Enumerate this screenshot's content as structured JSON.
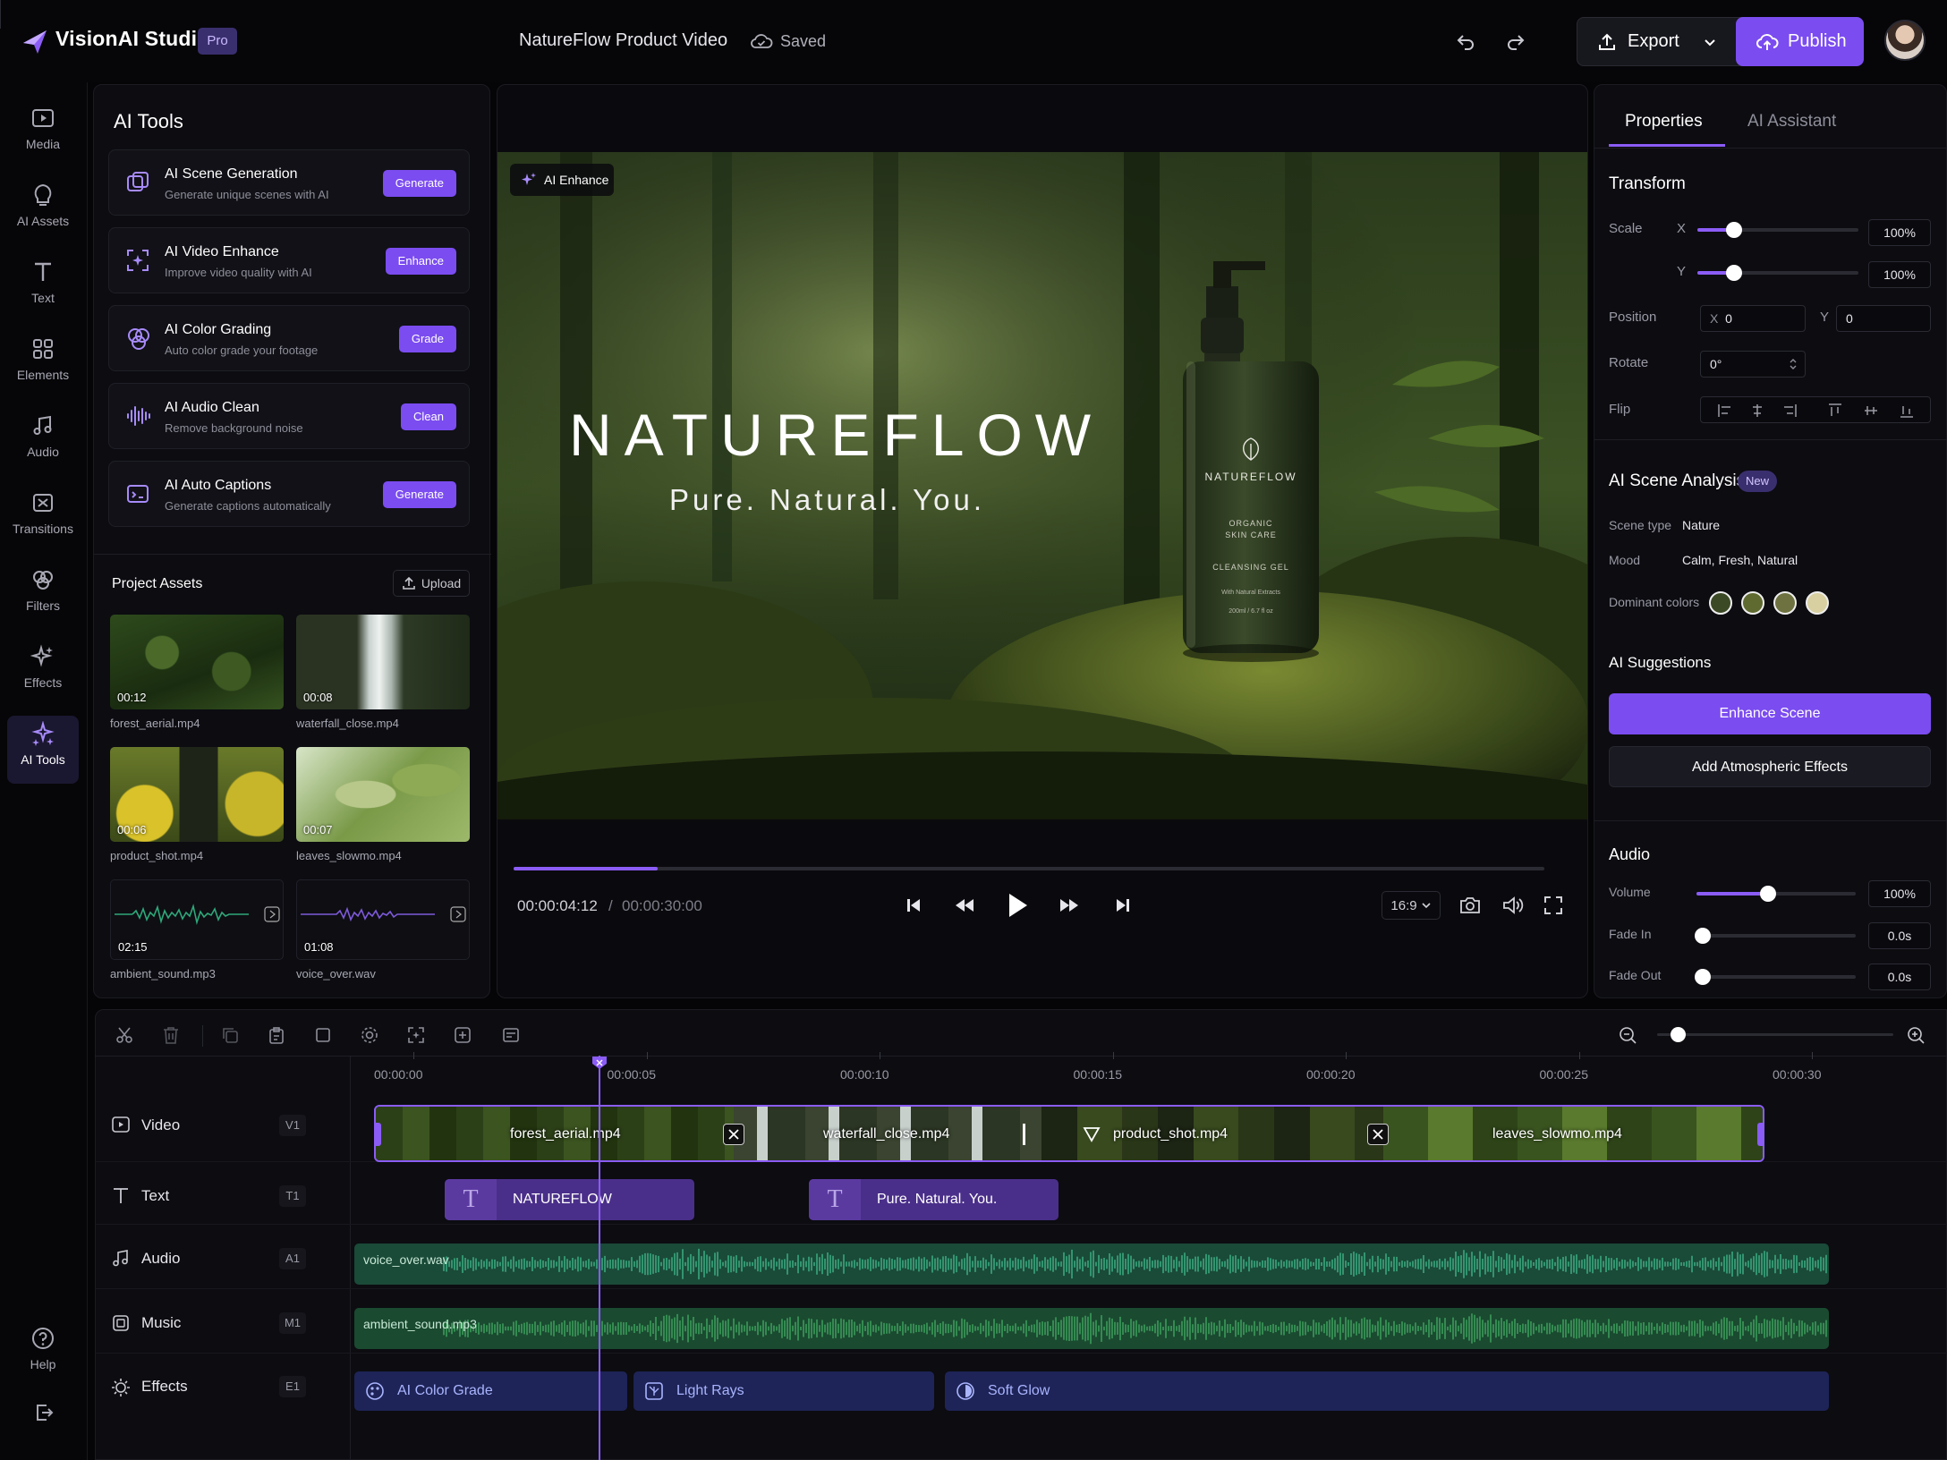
{
  "app": {
    "brand": "VisionAI Studio",
    "badge": "Pro",
    "project_title": "NatureFlow Product Video",
    "save_status": "Saved",
    "export_label": "Export",
    "publish_label": "Publish",
    "accent_color": "#7b4cf0"
  },
  "rail": {
    "items": [
      {
        "label": "Media",
        "icon": "media-icon"
      },
      {
        "label": "AI Assets",
        "icon": "ai-assets-icon"
      },
      {
        "label": "Text",
        "icon": "text-icon"
      },
      {
        "label": "Elements",
        "icon": "elements-icon"
      },
      {
        "label": "Audio",
        "icon": "audio-icon"
      },
      {
        "label": "Transitions",
        "icon": "transitions-icon"
      },
      {
        "label": "Filters",
        "icon": "filters-icon"
      },
      {
        "label": "Effects",
        "icon": "effects-icon"
      },
      {
        "label": "AI Tools",
        "icon": "ai-tools-icon",
        "active": true
      }
    ],
    "help_label": "Help"
  },
  "ai_tools": {
    "title": "AI Tools",
    "tools": [
      {
        "name": "AI Scene Generation",
        "desc": "Generate unique scenes with AI",
        "button": "Generate"
      },
      {
        "name": "AI Video Enhance",
        "desc": "Improve video quality with AI",
        "button": "Enhance"
      },
      {
        "name": "AI Color Grading",
        "desc": "Auto color grade your footage",
        "button": "Grade"
      },
      {
        "name": "AI Audio Clean",
        "desc": "Remove background noise",
        "button": "Clean"
      },
      {
        "name": "AI Auto Captions",
        "desc": "Generate captions automatically",
        "button": "Generate"
      }
    ]
  },
  "assets": {
    "title": "Project Assets",
    "upload_label": "Upload",
    "items": [
      {
        "name": "forest_aerial.mp4",
        "duration": "00:12"
      },
      {
        "name": "waterfall_close.mp4",
        "duration": "00:08"
      },
      {
        "name": "product_shot.mp4",
        "duration": "00:06"
      },
      {
        "name": "leaves_slowmo.mp4",
        "duration": "00:07"
      },
      {
        "name": "ambient_sound.mp3",
        "duration": "02:15"
      },
      {
        "name": "voice_over.wav",
        "duration": "01:08"
      }
    ]
  },
  "preview": {
    "badge": "AI Enhance",
    "hero_title": "NATUREFLOW",
    "hero_subtitle": "Pure. Natural. You.",
    "bottle_brand": "NATUREFLOW",
    "bottle_line1": "ORGANIC",
    "bottle_line2": "SKIN CARE",
    "bottle_product": "CLEANSING GEL",
    "bottle_note": "With Natural Extracts",
    "bottle_volume": "200ml / 6.7 fl oz",
    "current_time": "00:00:04:12",
    "separator": "/",
    "total_time": "00:00:30:00",
    "aspect_ratio": "16:9",
    "progress": 0.14
  },
  "properties": {
    "tabs": [
      "Properties",
      "AI Assistant"
    ],
    "transform": {
      "title": "Transform",
      "scale_label": "Scale",
      "x_label": "X",
      "y_label": "Y",
      "scale_x": "100%",
      "scale_y": "100%",
      "position_label": "Position",
      "pos_x": "0",
      "pos_y": "0",
      "rotate_label": "Rotate",
      "rotate": "0°",
      "flip_label": "Flip"
    },
    "scene_analysis": {
      "title": "AI Scene Analysis",
      "badge": "New",
      "scene_type_label": "Scene type",
      "scene_type": "Nature",
      "mood_label": "Mood",
      "mood": "Calm, Fresh, Natural",
      "colors_label": "Dominant colors",
      "colors": [
        "#3b4a25",
        "#5f6a30",
        "#6e7240",
        "#d8d0a0"
      ]
    },
    "suggestions": {
      "title": "AI Suggestions",
      "primary": "Enhance Scene",
      "secondary": "Add Atmospheric Effects"
    },
    "audio": {
      "title": "Audio",
      "volume_label": "Volume",
      "volume": "100%",
      "volume_level": 0.45,
      "fade_in_label": "Fade In",
      "fade_in": "0.0s",
      "fade_out_label": "Fade Out",
      "fade_out": "0.0s"
    }
  },
  "timeline": {
    "ruler": [
      "00:00:00",
      "00:00:05",
      "00:00:10",
      "00:00:15",
      "00:00:20",
      "00:00:25",
      "00:00:30"
    ],
    "tracks": [
      {
        "name": "Video",
        "id": "V1"
      },
      {
        "name": "Text",
        "id": "T1"
      },
      {
        "name": "Audio",
        "id": "A1"
      },
      {
        "name": "Music",
        "id": "M1"
      },
      {
        "name": "Effects",
        "id": "E1"
      }
    ],
    "video_clips": [
      "forest_aerial.mp4",
      "waterfall_close.mp4",
      "product_shot.mp4",
      "leaves_slowmo.mp4"
    ],
    "text_clips": [
      "NATUREFLOW",
      "Pure. Natural. You."
    ],
    "audio_clip": "voice_over.wav",
    "music_clip": "ambient_sound.mp3",
    "effect_clips": [
      "AI Color Grade",
      "Light Rays",
      "Soft Glow"
    ]
  }
}
